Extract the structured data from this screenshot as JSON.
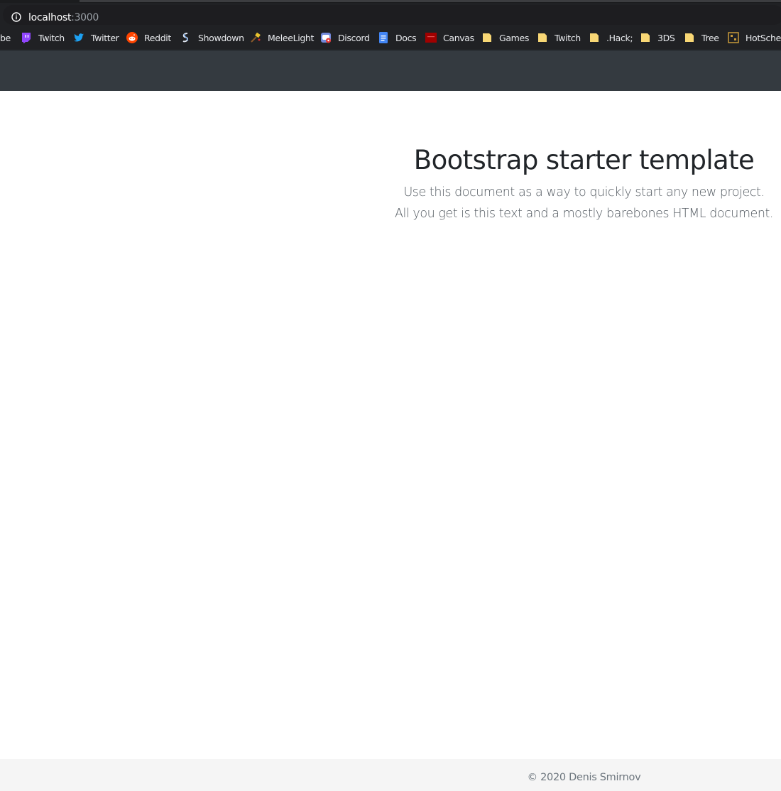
{
  "browser": {
    "url_host": "localhost",
    "url_port": ":3000",
    "bookmarks": [
      {
        "label": "be",
        "icon": "cut-off-icon"
      },
      {
        "label": "Twitch",
        "icon": "twitch-icon"
      },
      {
        "label": "Twitter",
        "icon": "twitter-icon"
      },
      {
        "label": "Reddit",
        "icon": "reddit-icon"
      },
      {
        "label": "Showdown",
        "icon": "showdown-icon"
      },
      {
        "label": "MeleeLight",
        "icon": "meleelight-icon"
      },
      {
        "label": "Discord",
        "icon": "discord-icon"
      },
      {
        "label": "Docs",
        "icon": "docs-icon"
      },
      {
        "label": "Canvas",
        "icon": "canvas-icon"
      },
      {
        "label": "Games",
        "icon": "folder-icon"
      },
      {
        "label": "Twitch",
        "icon": "folder-icon"
      },
      {
        "label": ".Hack;",
        "icon": "folder-icon"
      },
      {
        "label": "3DS",
        "icon": "folder-icon"
      },
      {
        "label": "Tree",
        "icon": "folder-icon"
      },
      {
        "label": "HotSched",
        "icon": "hotsched-icon"
      }
    ]
  },
  "main": {
    "title": "Bootstrap starter template",
    "lead_line1": "Use this document as a way to quickly start any new project.",
    "lead_line2": "All you get is this text and a mostly barebones HTML document."
  },
  "footer": {
    "copyright": "© 2020 Denis Smirnov"
  },
  "colors": {
    "chrome_bg": "#202124",
    "navbar_bg": "#343a40",
    "footer_bg": "#f5f5f5",
    "heading": "#212529",
    "lead": "#545b62",
    "footer_text": "#6c757d"
  }
}
